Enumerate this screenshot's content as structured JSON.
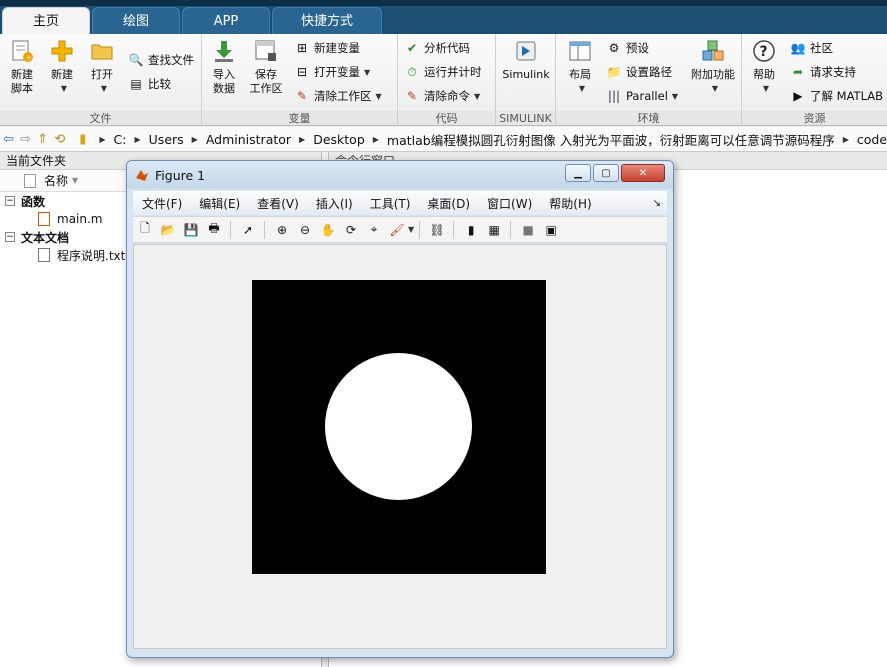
{
  "tabs": [
    {
      "label": "主页",
      "active": true
    },
    {
      "label": "绘图",
      "active": false
    },
    {
      "label": "APP",
      "active": false
    },
    {
      "label": "快捷方式",
      "active": false
    }
  ],
  "ribbon": {
    "file": {
      "title": "文件",
      "new_script": "新建\n脚本",
      "new": "新建",
      "open": "打开",
      "find_files": "查找文件",
      "compare": "比较"
    },
    "variable": {
      "title": "变量",
      "import": "导入\n数据",
      "save_workspace": "保存\n工作区",
      "new_variable": "新建变量",
      "open_variable": "打开变量",
      "clear_workspace": "清除工作区"
    },
    "code": {
      "title": "代码",
      "analyze": "分析代码",
      "run_timer": "运行并计时",
      "clear_commands": "清除命令"
    },
    "simulink": {
      "title": "SIMULINK",
      "label": "Simulink"
    },
    "environment": {
      "title": "环境",
      "layout": "布局",
      "preferences": "预设",
      "set_path": "设置路径",
      "parallel": "Parallel",
      "addons": "附加功能"
    },
    "resources": {
      "title": "资源",
      "help": "帮助",
      "community": "社区",
      "request_support": "请求支持",
      "learn_matlab": "了解 MATLAB"
    }
  },
  "address_bar": {
    "crumbs": [
      "C:",
      "Users",
      "Administrator",
      "Desktop",
      "matlab编程模拟圆孔衍射图像 入射光为平面波，衍射距离可以任意调节源码程序",
      "code"
    ]
  },
  "current_folder": {
    "title": "当前文件夹",
    "column_name": "名称",
    "groups": [
      {
        "label": "函数",
        "items": [
          "main.m"
        ]
      },
      {
        "label": "文本文档",
        "items": [
          "程序说明.txt"
        ]
      }
    ]
  },
  "command_window": {
    "title": "命令行窗口"
  },
  "figure": {
    "title": "Figure 1",
    "menu": [
      "文件(F)",
      "编辑(E)",
      "查看(V)",
      "插入(I)",
      "工具(T)",
      "桌面(D)",
      "窗口(W)",
      "帮助(H)"
    ],
    "image": {
      "background_color": "#000000",
      "aperture_color": "#ffffff",
      "aperture_diameter_fraction": 0.5
    }
  },
  "colors": {
    "tabbar": "#1d4f73",
    "tab_active": "#f5f5f5",
    "ribbon_bg": "#f0f0f0"
  }
}
